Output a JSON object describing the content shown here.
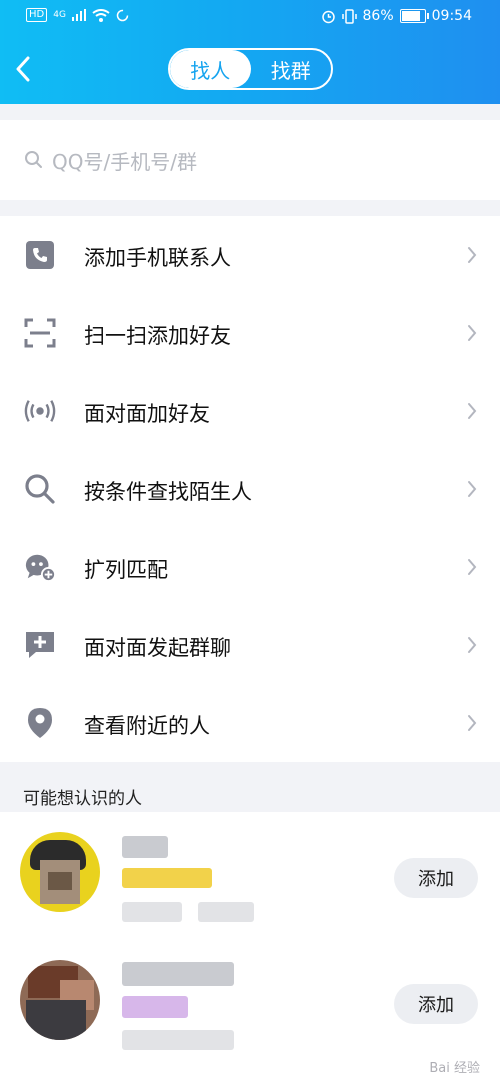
{
  "status_bar": {
    "network_badge": "HD",
    "network_type": "4G",
    "battery": "86%",
    "battery_level": 0.86,
    "time": "09:54"
  },
  "header": {
    "tabs": [
      {
        "label": "找人",
        "active": true
      },
      {
        "label": "找群",
        "active": false
      }
    ],
    "accent": "#16a4ef"
  },
  "search": {
    "placeholder": "QQ号/手机号/群"
  },
  "menu": [
    {
      "label": "添加手机联系人",
      "icon": "phone-icon"
    },
    {
      "label": "扫一扫添加好友",
      "icon": "scan-icon"
    },
    {
      "label": "面对面加好友",
      "icon": "radar-icon"
    },
    {
      "label": "按条件查找陌生人",
      "icon": "search-icon"
    },
    {
      "label": "扩列匹配",
      "icon": "chat-match-icon"
    },
    {
      "label": "面对面发起群聊",
      "icon": "group-chat-icon"
    },
    {
      "label": "查看附近的人",
      "icon": "location-icon"
    }
  ],
  "section_title": "可能想认识的人",
  "people": [
    {
      "add_label": "添加"
    },
    {
      "add_label": "添加"
    }
  ],
  "watermark": "Bai 经验"
}
